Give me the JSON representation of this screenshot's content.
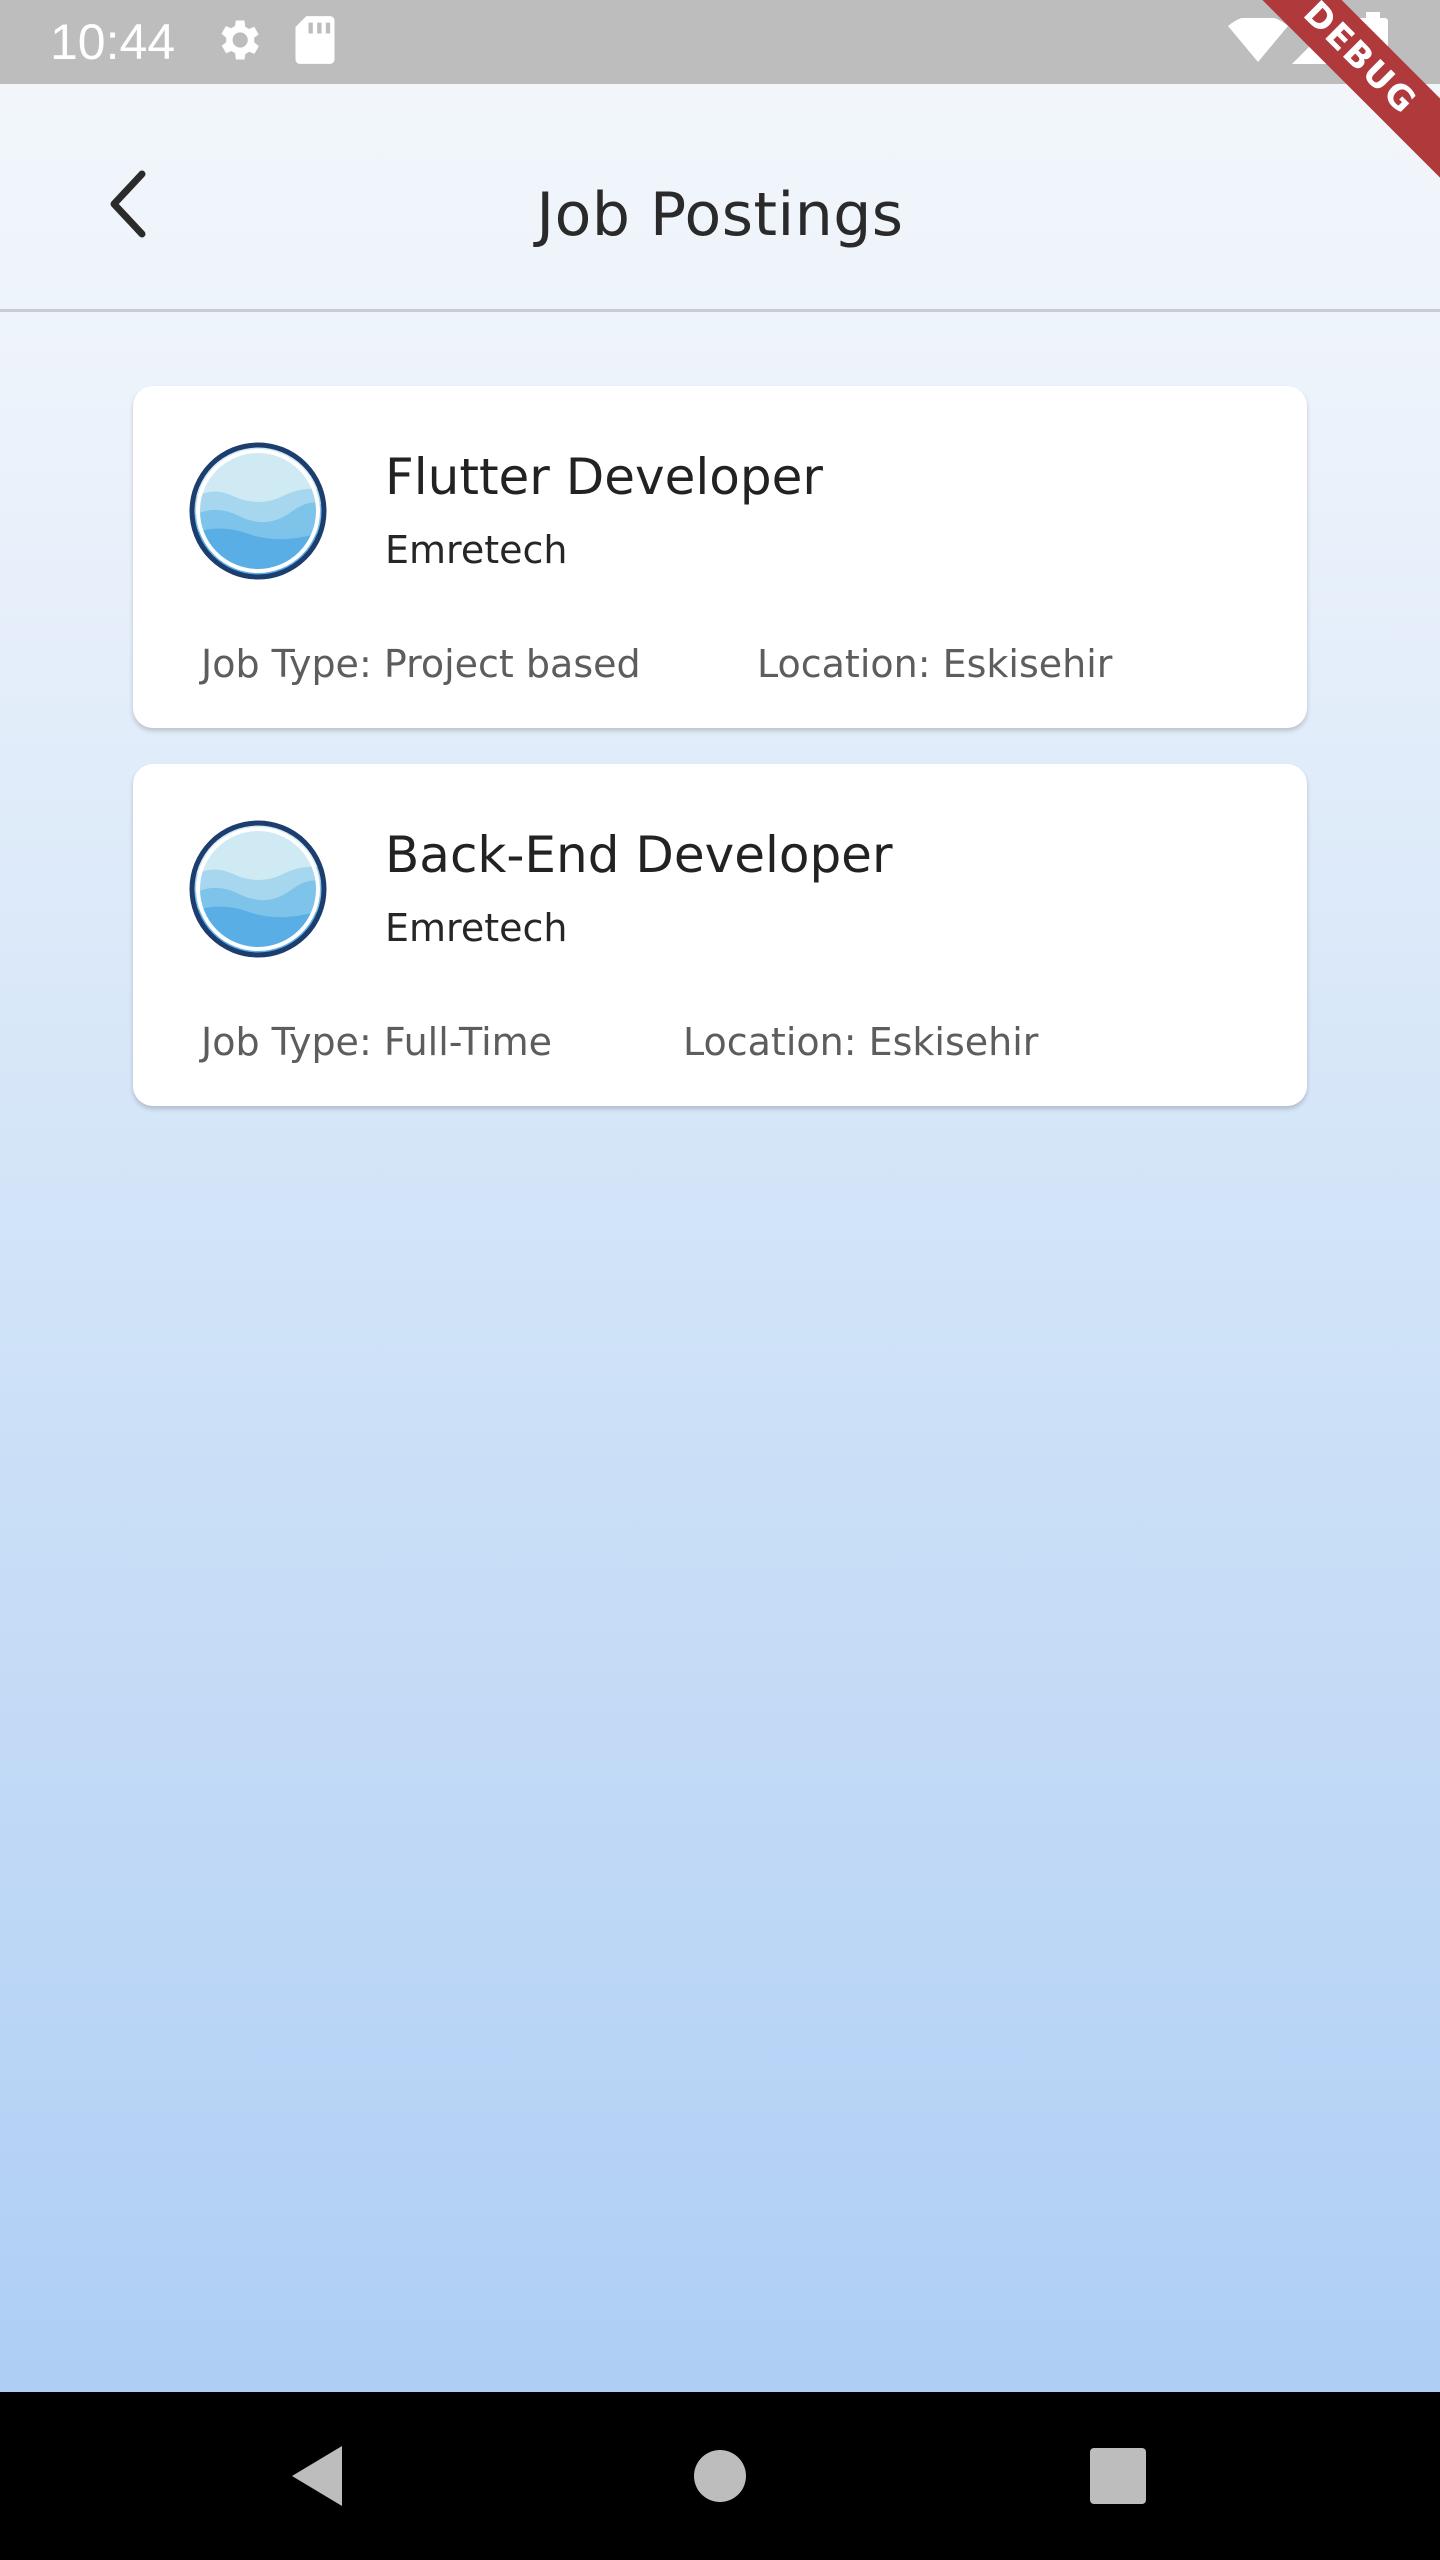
{
  "status_bar": {
    "time": "10:44",
    "icons": [
      "gear-icon",
      "sd-card-icon",
      "wifi-icon",
      "signal-icon",
      "battery-icon"
    ]
  },
  "debug_banner": "DEBUG",
  "app_bar": {
    "title": "Job Postings",
    "back_icon": "chevron-left-icon"
  },
  "jobs": [
    {
      "title": "Flutter Developer",
      "company": "Emretech",
      "job_type": "Job Type: Project based",
      "location": "Location: Eskisehir"
    },
    {
      "title": "Back-End Developer",
      "company": "Emretech",
      "job_type": "Job Type: Full-Time",
      "location": "Location: Eskisehir"
    }
  ],
  "nav_bar": {
    "buttons": [
      "back-triangle-icon",
      "home-circle-icon",
      "recents-square-icon"
    ]
  },
  "colors": {
    "logo_ring": "#1c3d6e",
    "debug_banner": "#b0393c",
    "card_bg": "#ffffff",
    "background_top": "#f3f7fb",
    "background_bottom": "#a9cbf4"
  }
}
